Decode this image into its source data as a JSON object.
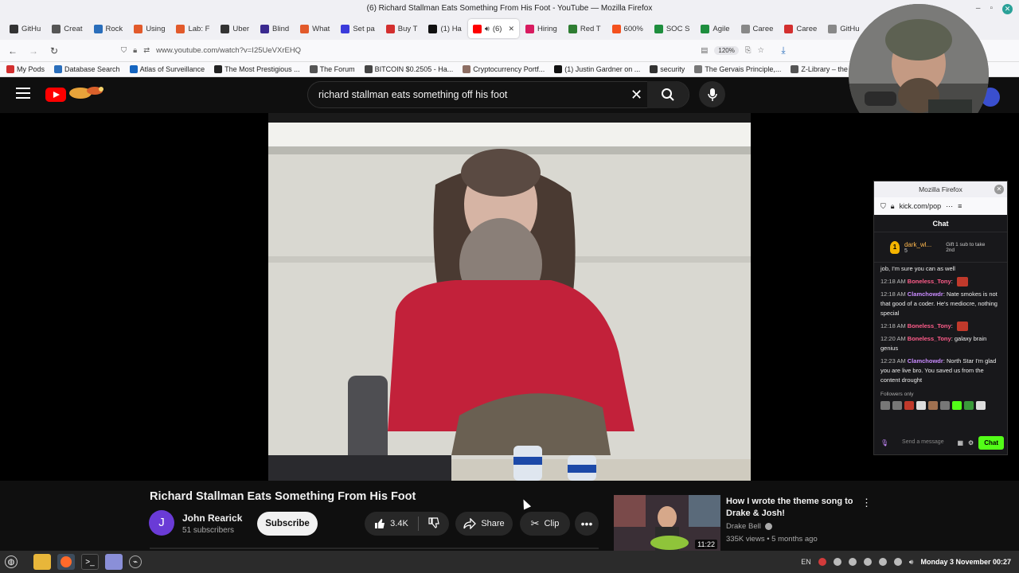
{
  "window": {
    "title": "(6) Richard Stallman Eats Something From His Foot - YouTube — Mozilla Firefox"
  },
  "tabs": [
    {
      "label": "GitHu",
      "color": "#333333"
    },
    {
      "label": "Creat",
      "color": "#555555"
    },
    {
      "label": "Rock",
      "color": "#2a6ebb"
    },
    {
      "label": "Using",
      "color": "#e25a2b"
    },
    {
      "label": "Lab: F",
      "color": "#e25a2b"
    },
    {
      "label": "Uber",
      "color": "#333333"
    },
    {
      "label": "Blind",
      "color": "#3b2a8f"
    },
    {
      "label": "What",
      "color": "#e25a2b"
    },
    {
      "label": "Set pa",
      "color": "#3b3bdb"
    },
    {
      "label": "Buy T",
      "color": "#d32f2f"
    },
    {
      "label": "(1) Ha",
      "color": "#111111"
    },
    {
      "label": "(6)",
      "color": "#ff0000",
      "active": true
    },
    {
      "label": "Hiring",
      "color": "#d81b60"
    },
    {
      "label": "Red T",
      "color": "#2e7d32"
    },
    {
      "label": "600%",
      "color": "#f4511e"
    },
    {
      "label": "SOC S",
      "color": "#1e8e3e"
    },
    {
      "label": "Agile",
      "color": "#1e8e3e"
    },
    {
      "label": "Caree",
      "color": "#888888"
    },
    {
      "label": "Caree",
      "color": "#d32f2f"
    },
    {
      "label": "GitHu",
      "color": "#888888"
    }
  ],
  "toolbar": {
    "url": "www.youtube.com/watch?v=I25UeVXrEHQ",
    "zoom": "120%"
  },
  "bookmarks": [
    {
      "label": "My Pods",
      "color": "#d32f2f"
    },
    {
      "label": "Database Search",
      "color": "#2a6ebb"
    },
    {
      "label": "Atlas of Surveillance",
      "color": "#1565c0"
    },
    {
      "label": "The Most Prestigious ...",
      "color": "#222222"
    },
    {
      "label": "The Forum",
      "color": "#555555"
    },
    {
      "label": "BITCOIN $0.2505 - Ha...",
      "color": "#444444"
    },
    {
      "label": "Cryptocurrency Portf...",
      "color": "#8d6e63"
    },
    {
      "label": "(1) Justin Gardner on ...",
      "color": "#111111"
    },
    {
      "label": "security",
      "color": "#333333"
    },
    {
      "label": "The Gervais Principle,...",
      "color": "#777777"
    },
    {
      "label": "Z-Library – the world'...",
      "color": "#555555"
    }
  ],
  "youtube": {
    "search_query": "richard stallman eats something off his foot",
    "video_title": "Richard Stallman Eats Something From His Foot",
    "channel_initial": "J",
    "channel_name": "John Rearick",
    "channel_subs": "51 subscribers",
    "subscribe_label": "Subscribe",
    "like_count": "3.4K",
    "share_label": "Share",
    "clip_label": "Clip",
    "recommendation": {
      "title": "How I wrote the theme song to Drake & Josh!",
      "channel": "Drake Bell",
      "meta": "335K views • 5 months ago",
      "duration": "11:22"
    }
  },
  "chat_popup": {
    "window_title": "Mozilla Firefox",
    "url": "kick.com/pop",
    "header": "Chat",
    "top_gifter": {
      "rank": "1",
      "name": "dark_wl...",
      "count": "5",
      "note": "Gift 1 sub to take 2nd"
    },
    "messages": [
      {
        "time": "",
        "user": "",
        "user_color": "#eeeeee",
        "text": "job, I'm sure you can as well"
      },
      {
        "time": "12:18 AM",
        "user": "Boneless_Tony",
        "user_color": "#ff5c8a",
        "text": "",
        "emote": true
      },
      {
        "time": "12:18 AM",
        "user": "Clamchowdr",
        "user_color": "#c98bff",
        "text": "Nate smokes is not that good of a coder. He's mediocre, nothing special"
      },
      {
        "time": "12:18 AM",
        "user": "Boneless_Tony",
        "user_color": "#ff5c8a",
        "text": "",
        "emote": true
      },
      {
        "time": "12:20 AM",
        "user": "Boneless_Tony",
        "user_color": "#ff5c8a",
        "text": "galaxy brain genius"
      },
      {
        "time": "12:23 AM",
        "user": "Clamchowdr",
        "user_color": "#c98bff",
        "text": "North Star I'm glad you are live bro. You saved us from the content drought"
      }
    ],
    "followers_only": "Followers only",
    "input_placeholder": "Send a message",
    "send_label": "Chat"
  },
  "taskbar": {
    "lang": "EN",
    "clock": "Monday  3 November 00:27"
  }
}
